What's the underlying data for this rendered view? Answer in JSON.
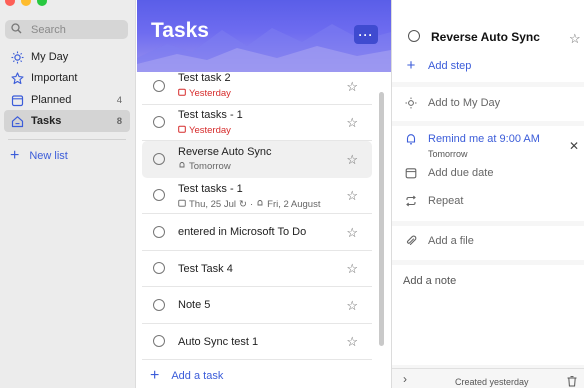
{
  "sidebar": {
    "search_placeholder": "Search",
    "items": [
      {
        "label": "My Day",
        "count": "",
        "icon": "sun-icon"
      },
      {
        "label": "Important",
        "count": "",
        "icon": "star-icon"
      },
      {
        "label": "Planned",
        "count": "4",
        "icon": "calendar-icon"
      },
      {
        "label": "Tasks",
        "count": "8",
        "icon": "home-icon"
      }
    ],
    "new_list_label": "New list"
  },
  "list": {
    "title": "Tasks",
    "more_label": "···",
    "add_task_label": "Add a task",
    "tasks": [
      {
        "title": "Test task 2",
        "due": "Yesterday",
        "overdue": true
      },
      {
        "title": "Test tasks - 1",
        "due": "Yesterday",
        "overdue": true
      },
      {
        "title": "Reverse Auto Sync",
        "reminder": "Tomorrow",
        "selected": true
      },
      {
        "title": "Test tasks - 1",
        "due": "Thu, 25 Jul",
        "reminder": "Fri, 2 August"
      },
      {
        "title": "entered in Microsoft To Do"
      },
      {
        "title": "Test Task 4"
      },
      {
        "title": "Note 5"
      },
      {
        "title": "Auto Sync test 1"
      }
    ]
  },
  "detail": {
    "title": "Reverse Auto Sync",
    "add_step_label": "Add step",
    "add_to_my_day_label": "Add to My Day",
    "remind_label": "Remind me at 9:00 AM",
    "remind_sub": "Tomorrow",
    "due_label": "Add due date",
    "repeat_label": "Repeat",
    "file_label": "Add a file",
    "note_placeholder": "Add a note",
    "created_label": "Created yesterday"
  },
  "colors": {
    "accent": "#3b5cd9",
    "overdue": "#d62b2b",
    "header_top": "#5a5ee8",
    "header_bottom": "#9a93ee"
  }
}
